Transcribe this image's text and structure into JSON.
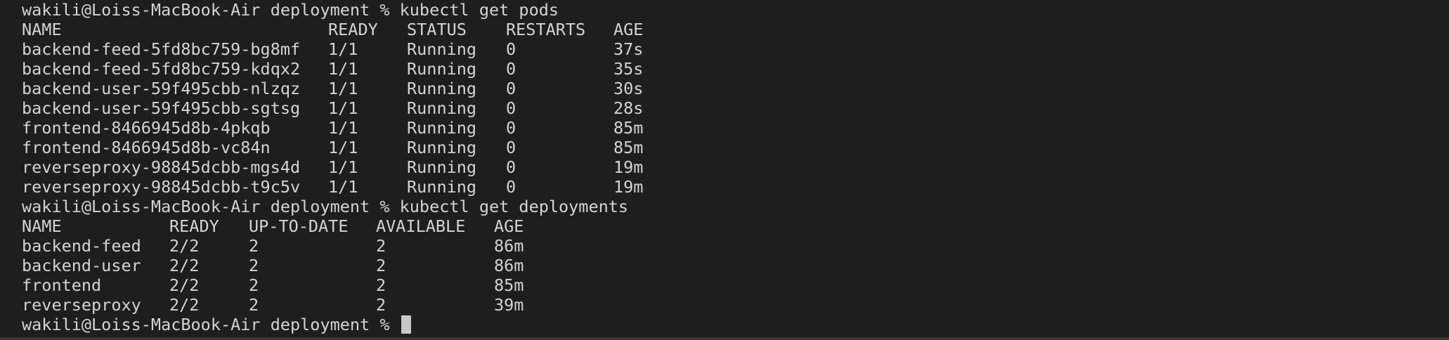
{
  "prompt": "wakili@Loiss-MacBook-Air deployment % ",
  "commands": {
    "pods": "kubectl get pods",
    "deployments": "kubectl get deployments"
  },
  "pods_table": {
    "headers": [
      "NAME",
      "READY",
      "STATUS",
      "RESTARTS",
      "AGE"
    ],
    "rows": [
      [
        "backend-feed-5fd8bc759-bg8mf",
        "1/1",
        "Running",
        "0",
        "37s"
      ],
      [
        "backend-feed-5fd8bc759-kdqx2",
        "1/1",
        "Running",
        "0",
        "35s"
      ],
      [
        "backend-user-59f495cbb-nlzqz",
        "1/1",
        "Running",
        "0",
        "30s"
      ],
      [
        "backend-user-59f495cbb-sgtsg",
        "1/1",
        "Running",
        "0",
        "28s"
      ],
      [
        "frontend-8466945d8b-4pkqb",
        "1/1",
        "Running",
        "0",
        "85m"
      ],
      [
        "frontend-8466945d8b-vc84n",
        "1/1",
        "Running",
        "0",
        "85m"
      ],
      [
        "reverseproxy-98845dcbb-mgs4d",
        "1/1",
        "Running",
        "0",
        "19m"
      ],
      [
        "reverseproxy-98845dcbb-t9c5v",
        "1/1",
        "Running",
        "0",
        "19m"
      ]
    ]
  },
  "deployments_table": {
    "headers": [
      "NAME",
      "READY",
      "UP-TO-DATE",
      "AVAILABLE",
      "AGE"
    ],
    "rows": [
      [
        "backend-feed",
        "2/2",
        "2",
        "2",
        "86m"
      ],
      [
        "backend-user",
        "2/2",
        "2",
        "2",
        "86m"
      ],
      [
        "frontend",
        "2/2",
        "2",
        "2",
        "85m"
      ],
      [
        "reverseproxy",
        "2/2",
        "2",
        "2",
        "39m"
      ]
    ]
  },
  "colors": {
    "background": "#1e1e1e",
    "text": "#d4d4d4",
    "cursor": "#c8c8c8"
  }
}
